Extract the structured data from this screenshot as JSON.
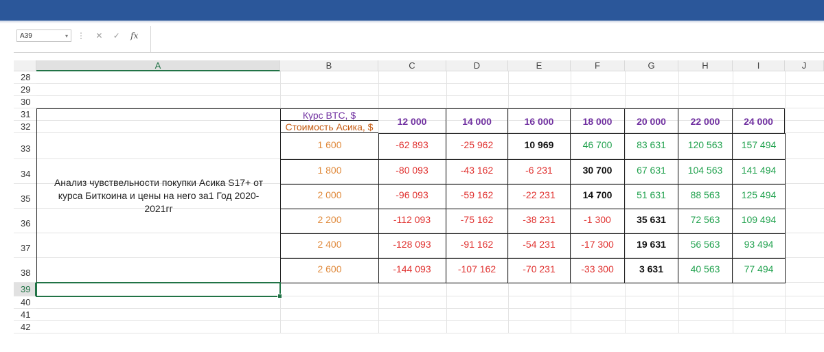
{
  "formula_bar": {
    "name_box": "A39",
    "cancel_icon": "✕",
    "enter_icon": "✓",
    "fx_label": "fx"
  },
  "columns": [
    "A",
    "B",
    "C",
    "D",
    "E",
    "F",
    "G",
    "H",
    "I",
    "J"
  ],
  "rows": [
    "28",
    "29",
    "30",
    "31",
    "32",
    "33",
    "34",
    "35",
    "36",
    "37",
    "38",
    "39",
    "40",
    "41",
    "42"
  ],
  "table": {
    "merged_title": "Анализ чувствельности покупки Асика S17+ от курса Биткоина и цены на него за1 Год 2020-2021гг",
    "btc_label": "Курс BTC, $",
    "asic_label": "Стоимость Асика, $",
    "btc_prices": [
      "12 000",
      "14 000",
      "16 000",
      "18 000",
      "20 000",
      "22 000",
      "24 000"
    ],
    "asic_prices": [
      "1 600",
      "1 800",
      "2 000",
      "2 200",
      "2 400",
      "2 600"
    ],
    "values": [
      [
        "-62 893",
        "-25 962",
        "10 969",
        "46 700",
        "83 631",
        "120 563",
        "157 494"
      ],
      [
        "-80 093",
        "-43 162",
        "-6 231",
        "30 700",
        "67 631",
        "104 563",
        "141 494"
      ],
      [
        "-96 093",
        "-59 162",
        "-22 231",
        "14 700",
        "51 631",
        "88 563",
        "125 494"
      ],
      [
        "-112 093",
        "-75 162",
        "-38 231",
        "-1 300",
        "35 631",
        "72 563",
        "109 494"
      ],
      [
        "-128 093",
        "-91 162",
        "-54 231",
        "-17 300",
        "19 631",
        "56 563",
        "93 494"
      ],
      [
        "-144 093",
        "-107 162",
        "-70 231",
        "-33 300",
        "3 631",
        "40 563",
        "77 494"
      ]
    ],
    "styles": [
      [
        "red",
        "red",
        "black",
        "green",
        "green",
        "green",
        "green"
      ],
      [
        "red",
        "red",
        "red",
        "black",
        "green",
        "green",
        "green"
      ],
      [
        "red",
        "red",
        "red",
        "black",
        "green",
        "green",
        "green"
      ],
      [
        "red",
        "red",
        "red",
        "red",
        "black",
        "green",
        "green"
      ],
      [
        "red",
        "red",
        "red",
        "red",
        "black",
        "green",
        "green"
      ],
      [
        "red",
        "red",
        "red",
        "red",
        "black",
        "green",
        "green"
      ]
    ]
  },
  "colors": {
    "title_bar": "#2b579a",
    "selection": "#217346",
    "negative": "#e0312f",
    "positive": "#22a24f",
    "header_purple": "#7030a0",
    "header_orange": "#c55a11"
  }
}
